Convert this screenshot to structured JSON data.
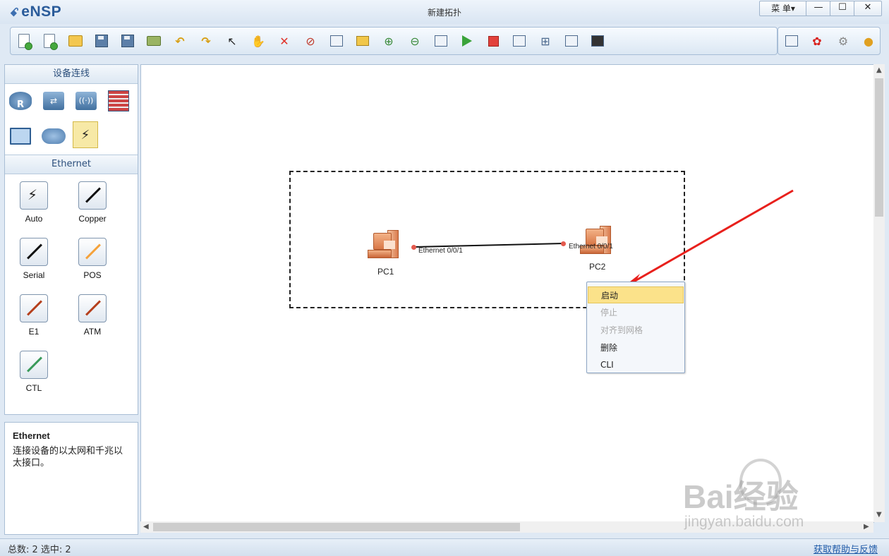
{
  "app": {
    "name": "eNSP",
    "window_title": "新建拓扑",
    "menu_label": "菜 单▾",
    "min_glyph": "—",
    "max_glyph": "☐",
    "close_glyph": "✕"
  },
  "toolbar": {
    "icons": [
      "new-topology-icon",
      "new-lab-icon",
      "open-icon",
      "save-icon",
      "save-as-icon",
      "print-icon",
      "undo-icon",
      "redo-icon",
      "select-icon",
      "hand-icon",
      "delete-icon",
      "delete-link-icon",
      "text-note-icon",
      "rectangle-icon",
      "zoom-in-icon",
      "zoom-out-icon",
      "fit-icon",
      "start-icon",
      "stop-icon",
      "capture-icon",
      "topology-icon",
      "grid-icon",
      "screen-icon"
    ],
    "right_icons": [
      "chat-icon",
      "huawei-icon",
      "settings-icon",
      "help-icon"
    ]
  },
  "left": {
    "devices_header": "设备连线",
    "cables_header": "Ethernet",
    "cables": [
      {
        "label": "Auto",
        "color": "#111111"
      },
      {
        "label": "Copper",
        "color": "#111111"
      },
      {
        "label": "Serial",
        "color": "#111111"
      },
      {
        "label": "POS",
        "color": "#f5a23b"
      },
      {
        "label": "E1",
        "color": "#b5401d"
      },
      {
        "label": "ATM",
        "color": "#b5401d"
      },
      {
        "label": "CTL",
        "color": "#3a9a5a"
      }
    ]
  },
  "description": {
    "title": "Ethernet",
    "text": "连接设备的以太网和千兆以太接口。"
  },
  "topology": {
    "pc1": {
      "label": "PC1",
      "port": "Ethernet 0/0/1"
    },
    "pc2": {
      "label": "PC2",
      "port": "Ethernet 0/0/1"
    }
  },
  "context_menu": {
    "items": [
      {
        "label": "启动",
        "state": "highlighted"
      },
      {
        "label": "停止",
        "state": "disabled"
      },
      {
        "label": "对齐到网格",
        "state": "disabled"
      },
      {
        "label": "删除",
        "state": "enabled"
      },
      {
        "label": "CLI",
        "state": "enabled"
      }
    ]
  },
  "status": {
    "left": "总数: 2 选中: 2",
    "right": "获取帮助与反馈"
  },
  "watermark": {
    "main": "Bai经验",
    "sub": "jingyan.baidu.com"
  },
  "colors": {
    "accent": "#2a5b9a",
    "arrow": "#e8201c",
    "link_port": "#e45a4e",
    "menu_highlight": "#fbe28a"
  }
}
